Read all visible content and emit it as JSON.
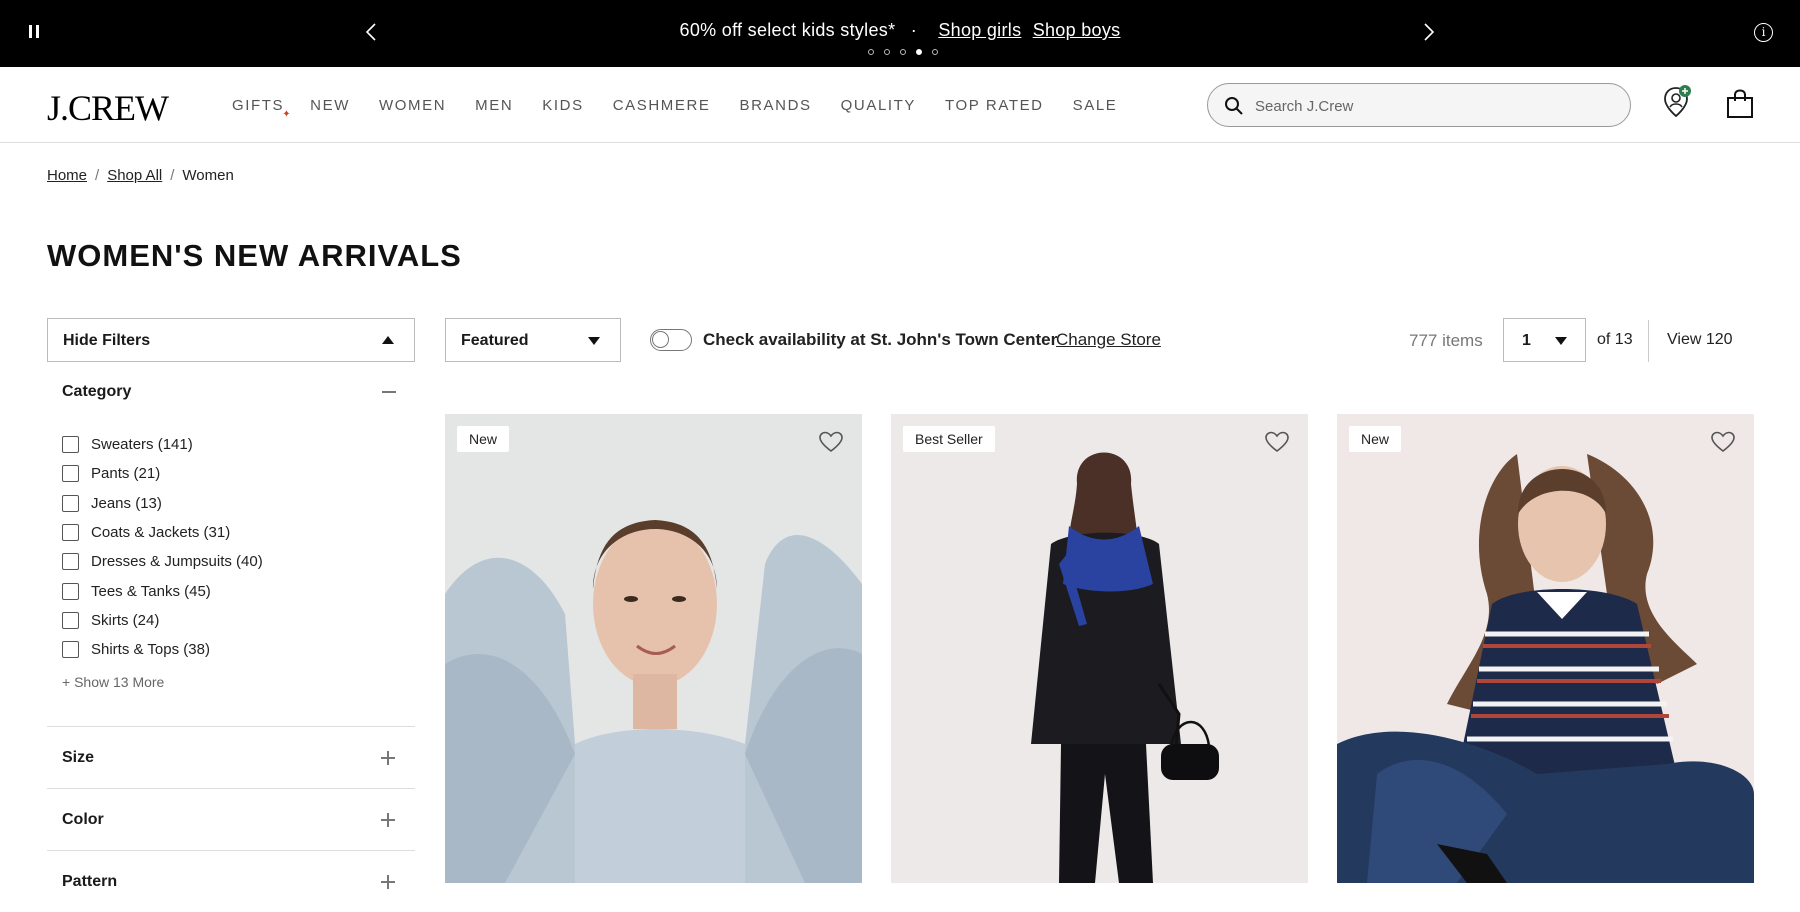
{
  "promo": {
    "message": "60% off select kids styles*",
    "separator": "·",
    "link_girls": "Shop girls",
    "link_boys": "Shop boys",
    "info_glyph": "i",
    "dot_count": 5,
    "active_dot": 4
  },
  "header": {
    "logo": "J.CREW",
    "nav": [
      "GIFTS",
      "NEW",
      "WOMEN",
      "MEN",
      "KIDS",
      "CASHMERE",
      "BRANDS",
      "QUALITY",
      "TOP RATED",
      "SALE"
    ],
    "search_placeholder": "Search J.Crew",
    "accent_color": "#c8401f"
  },
  "breadcrumb": {
    "items": [
      "Home",
      "Shop All",
      "Women"
    ],
    "separator": "/"
  },
  "page_title": "WOMEN'S NEW ARRIVALS",
  "filters": {
    "toggle_label": "Hide Filters",
    "category_title": "Category",
    "categories": [
      "Sweaters (141)",
      "Pants (21)",
      "Jeans (13)",
      "Coats & Jackets (31)",
      "Dresses & Jumpsuits (40)",
      "Tees & Tanks (45)",
      "Skirts (24)",
      "Shirts & Tops (38)"
    ],
    "show_more": "+ Show 13 More",
    "facets": [
      "Size",
      "Color",
      "Pattern"
    ]
  },
  "toolbar": {
    "sort_value": "Featured",
    "availability_label": "Check availability at St. John's Town Center",
    "change_store": "Change Store",
    "item_count": "777 items",
    "page_value": "1",
    "page_of": "of 13",
    "view_label": "View 120"
  },
  "products": [
    {
      "badge": "New",
      "photo": "woman-light-blue-sweater"
    },
    {
      "badge": "Best Seller",
      "photo": "woman-black-suit-blue-scarf"
    },
    {
      "badge": "New",
      "photo": "woman-striped-sweater-jeans"
    }
  ]
}
